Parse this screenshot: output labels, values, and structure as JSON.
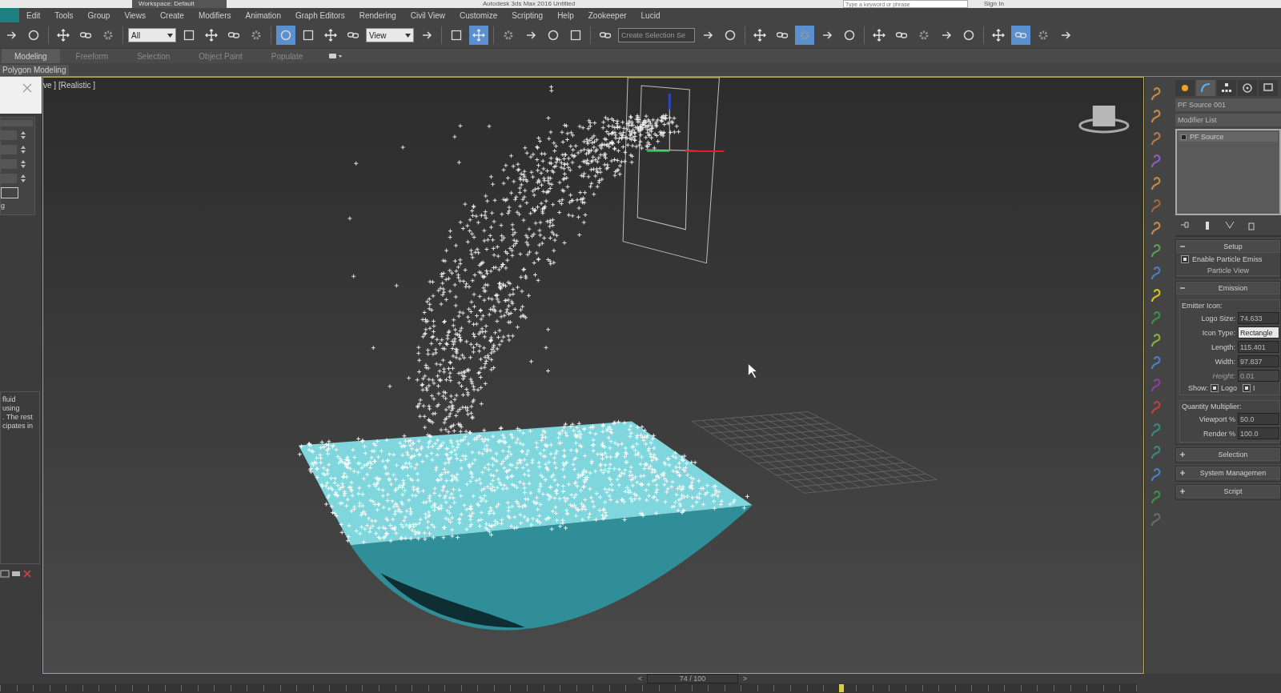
{
  "title_bar": {
    "workspace": "Workspace: Default",
    "title": "Autodesk 3ds Max 2016    Untitled",
    "search": {
      "placeholder": "Type a keyword or phrase"
    },
    "sign_in": "Sign In"
  },
  "menu": [
    "Edit",
    "Tools",
    "Group",
    "Views",
    "Create",
    "Modifiers",
    "Animation",
    "Graph Editors",
    "Rendering",
    "Civil View",
    "Customize",
    "Scripting",
    "Help",
    "Zookeeper",
    "Lucid"
  ],
  "toolbar": [
    {
      "kind": "button",
      "selected": false
    },
    {
      "kind": "button",
      "selected": false
    },
    {
      "kind": "separator"
    },
    {
      "kind": "button",
      "selected": false
    },
    {
      "kind": "button",
      "selected": false
    },
    {
      "kind": "button",
      "selected": false
    },
    {
      "kind": "separator"
    },
    {
      "kind": "dropdown",
      "value": "All"
    },
    {
      "kind": "button",
      "selected": false
    },
    {
      "kind": "button",
      "selected": false
    },
    {
      "kind": "button",
      "selected": false
    },
    {
      "kind": "button",
      "selected": false
    },
    {
      "kind": "separator"
    },
    {
      "kind": "button",
      "selected": true
    },
    {
      "kind": "button",
      "selected": false
    },
    {
      "kind": "button",
      "selected": false
    },
    {
      "kind": "button",
      "selected": false
    },
    {
      "kind": "dropdown",
      "value": "View"
    },
    {
      "kind": "button",
      "selected": false
    },
    {
      "kind": "separator"
    },
    {
      "kind": "button",
      "selected": false
    },
    {
      "kind": "button",
      "selected": true
    },
    {
      "kind": "separator"
    },
    {
      "kind": "button",
      "selected": false
    },
    {
      "kind": "button",
      "selected": false
    },
    {
      "kind": "button",
      "selected": false
    },
    {
      "kind": "button",
      "selected": false
    },
    {
      "kind": "separator"
    },
    {
      "kind": "button",
      "selected": false
    },
    {
      "kind": "dropdown",
      "placeholder": "Create Selection Se"
    },
    {
      "kind": "button",
      "selected": false
    },
    {
      "kind": "button",
      "selected": false
    },
    {
      "kind": "separator"
    },
    {
      "kind": "button",
      "selected": false
    },
    {
      "kind": "button",
      "selected": false
    },
    {
      "kind": "button",
      "selected": true
    },
    {
      "kind": "button",
      "selected": false
    },
    {
      "kind": "button",
      "selected": false
    },
    {
      "kind": "separator"
    },
    {
      "kind": "button",
      "selected": false
    },
    {
      "kind": "button",
      "selected": false
    },
    {
      "kind": "button",
      "selected": false
    },
    {
      "kind": "button",
      "selected": false
    },
    {
      "kind": "button",
      "selected": false
    },
    {
      "kind": "separator"
    },
    {
      "kind": "button",
      "selected": false
    },
    {
      "kind": "button",
      "selected": true
    },
    {
      "kind": "button",
      "selected": false
    },
    {
      "kind": "button",
      "selected": false
    }
  ],
  "ribbon": {
    "tabs": [
      {
        "label": "Modeling",
        "selected": true
      },
      {
        "label": "Freeform",
        "selected": false
      },
      {
        "label": "Selection",
        "selected": false
      },
      {
        "label": "Object Paint",
        "selected": false
      },
      {
        "label": "Populate",
        "selected": false
      }
    ],
    "panel_label": "Polygon Modeling"
  },
  "left_panel": {
    "label_fragment": "g",
    "description_lines": [
      "fluid",
      "using",
      ". The rest",
      "cipates in"
    ]
  },
  "viewport": {
    "label": "ve ] [Realistic ]"
  },
  "command_panel": {
    "tabs": [
      {
        "selected": false
      },
      {
        "selected": true
      },
      {
        "selected": false
      },
      {
        "selected": false
      },
      {
        "selected": false
      }
    ],
    "object_name": "PF Source 001",
    "modifier_list": "Modifier List",
    "stack": [
      "PF Source"
    ],
    "rollouts": [
      {
        "title": "Setup",
        "expanded": true,
        "kind": "setup",
        "checkbox": {
          "label": "Enable Particle Emiss",
          "checked": true
        },
        "button": "Particle View"
      },
      {
        "title": "Emission",
        "expanded": true,
        "kind": "emission",
        "groups": [
          {
            "title": "Emitter Icon:",
            "fields": [
              {
                "label": "Logo Size:",
                "value": "74.633",
                "kind": "spinner",
                "disabled": false
              },
              {
                "label": "Icon Type:",
                "value": "Rectangle",
                "kind": "dropdown",
                "disabled": false
              },
              {
                "label": "Length:",
                "value": "115.401",
                "kind": "spinner",
                "disabled": false
              },
              {
                "label": "Width:",
                "value": "97.837",
                "kind": "spinner",
                "disabled": false
              },
              {
                "label": "Height:",
                "value": "0.01",
                "kind": "spinner",
                "disabled": true
              }
            ],
            "show": {
              "label": "Show:",
              "checks": [
                {
                  "label": "Logo",
                  "checked": true
                },
                {
                  "label": "I",
                  "checked": true
                }
              ]
            }
          },
          {
            "title": "Quantity Multiplier:",
            "fields": [
              {
                "label": "Viewport %",
                "value": "50.0",
                "kind": "spinner",
                "disabled": false
              },
              {
                "label": "Render %",
                "value": "100.0",
                "kind": "spinner",
                "disabled": false
              }
            ]
          }
        ]
      },
      {
        "title": "Selection",
        "expanded": false
      },
      {
        "title": "System Managemen",
        "expanded": false
      },
      {
        "title": "Script",
        "expanded": false
      }
    ]
  },
  "time_slider": {
    "label": "74 / 100",
    "level": 0.74,
    "prev": "<",
    "next": ">"
  }
}
